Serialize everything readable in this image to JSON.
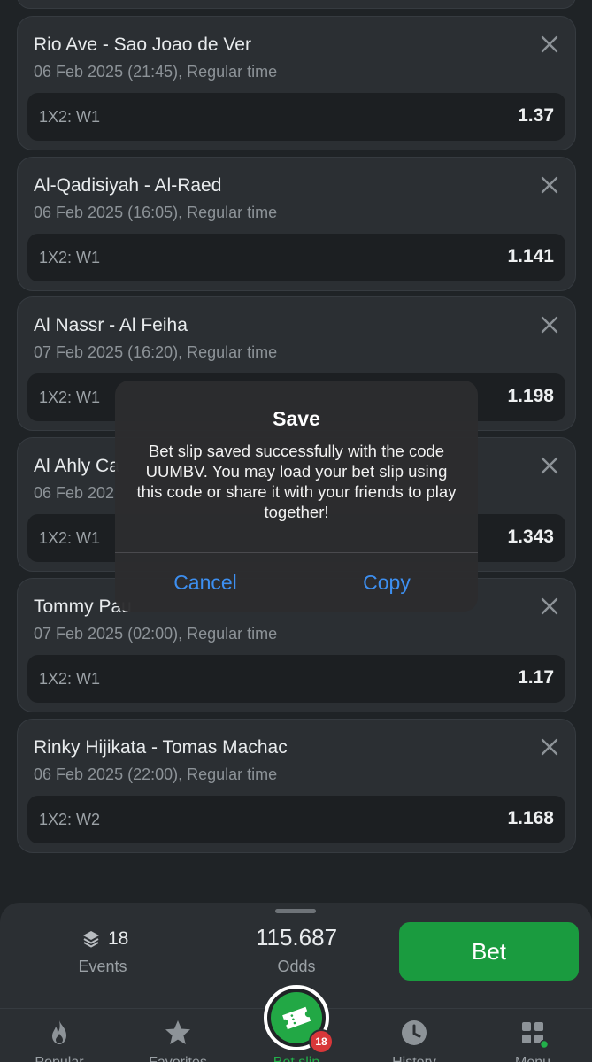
{
  "selections": [
    {
      "teams": "Rio Ave - Sao Joao de Ver",
      "date": "06 Feb 2025 (21:45), Regular time",
      "market": "1X2: W1",
      "odd": "1.37"
    },
    {
      "teams": "Al-Qadisiyah - Al-Raed",
      "date": "06 Feb 2025 (16:05), Regular time",
      "market": "1X2: W1",
      "odd": "1.141"
    },
    {
      "teams": "Al Nassr - Al Feiha",
      "date": "07 Feb 2025 (16:20), Regular time",
      "market": "1X2: W1",
      "odd": "1.198"
    },
    {
      "teams": "Al Ahly Ca",
      "date": "06 Feb 202",
      "market": "1X2: W1",
      "odd": "1.343"
    },
    {
      "teams": "Tommy Pau",
      "date": "07 Feb 2025 (02:00), Regular time",
      "market": "1X2: W1",
      "odd": "1.17"
    },
    {
      "teams": "Rinky Hijikata - Tomas Machac",
      "date": "06 Feb 2025 (22:00), Regular time",
      "market": "1X2: W2",
      "odd": "1.168"
    }
  ],
  "dialog": {
    "title": "Save",
    "message": "Bet slip saved successfully with the code UUMBV. You may load your bet slip using this code or share it with your friends to play together!",
    "cancel_label": "Cancel",
    "copy_label": "Copy"
  },
  "summary": {
    "events_count": "18",
    "events_label": "Events",
    "odds_value": "115.687",
    "odds_label": "Odds",
    "bet_label": "Bet"
  },
  "tabs": [
    {
      "label": "Popular",
      "icon": "flame-icon"
    },
    {
      "label": "Favorites",
      "icon": "star-icon"
    },
    {
      "label": "Bet slip",
      "icon": "ticket-icon",
      "badge": "18"
    },
    {
      "label": "History",
      "icon": "clock-icon"
    },
    {
      "label": "Menu",
      "icon": "grid-menu-icon"
    }
  ],
  "colors": {
    "accent_green": "#1a9b3f",
    "link_blue": "#3d8ff0",
    "badge_red": "#d8373a",
    "background": "#1f2326",
    "card": "#2b2f33"
  }
}
